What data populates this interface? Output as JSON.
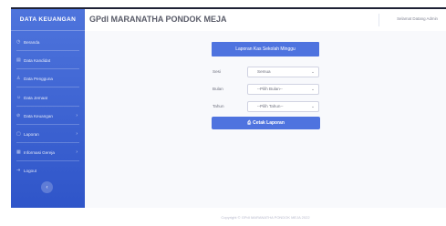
{
  "sidebar": {
    "brand": "DATA KEUANGAN",
    "items": [
      {
        "label": "Beranda",
        "icon": "dashboard-icon"
      },
      {
        "label": "Data Kandidat",
        "icon": "table-icon"
      },
      {
        "label": "Data Pengguna",
        "icon": "user-icon"
      },
      {
        "label": "Data Jemaat",
        "icon": "users-icon"
      },
      {
        "label": "Data Keuangan",
        "icon": "money-icon",
        "chevron": "›"
      },
      {
        "label": "Laporan",
        "icon": "report-icon",
        "chevron": "›"
      },
      {
        "label": "Informasi Gereja",
        "icon": "info-icon",
        "chevron": "›"
      },
      {
        "label": "Logout",
        "icon": "logout-icon"
      }
    ],
    "toggle_glyph": "‹"
  },
  "header": {
    "title": "GPdI MARANATHA PONDOK MEJA",
    "user": "Selamat Datang Admin"
  },
  "report": {
    "card_title": "Laporan Kas Sekolah Minggu",
    "fields": [
      {
        "label": "Sesi",
        "value": "Semua"
      },
      {
        "label": "Bulan",
        "value": "--Pilih Bulan--"
      },
      {
        "label": "Tahun",
        "value": "--Pilih Tahun--"
      }
    ],
    "print_label": "Cetak Laporan"
  },
  "footer": {
    "text": "Copyright © GPdI MARANATHA PONDOK MEJA 2022"
  }
}
